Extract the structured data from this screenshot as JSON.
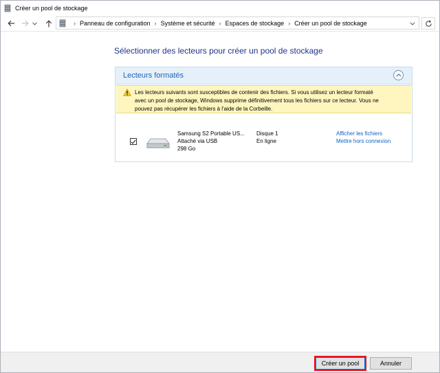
{
  "window": {
    "title": "Créer un pool de stockage"
  },
  "breadcrumb": [
    "Panneau de configuration",
    "Système et sécurité",
    "Espaces de stockage",
    "Créer un pool de stockage"
  ],
  "main": {
    "heading": "Sélectionner des lecteurs pour créer un pool de stockage",
    "panel": {
      "title": "Lecteurs formatés",
      "warning_lines": [
        "Les lecteurs suivants sont susceptibles de contenir des fichiers. Si vous utilisez un lecteur formaté",
        "avec un pool de stockage, Windows supprime définitivement tous les fichiers sur ce lecteur. Vous ne",
        "pouvez pas récupérer les fichiers à l'aide de la Corbeille."
      ],
      "drive": {
        "name": "Samsung S2 Portable US...",
        "connection": "Attaché via USB",
        "size": "298 Go",
        "disk": "Disque 1",
        "status": "En ligne",
        "checked": true,
        "actions": [
          "Afficher les fichiers",
          "Mettre hors connexion"
        ]
      }
    }
  },
  "footer": {
    "create_label": "Créer un pool",
    "cancel_label": "Annuler"
  },
  "colors": {
    "heading": "#1e3287",
    "panel_title": "#1f63b4",
    "link": "#0b62c4",
    "warning_bg": "#fff6bf",
    "highlight": "#e81123"
  },
  "icons": [
    "storage-spaces-icon",
    "back-arrow-icon",
    "forward-arrow-icon",
    "dropdown-arrow-icon",
    "up-arrow-icon",
    "chevron-right-icon",
    "chevron-down-icon",
    "refresh-icon",
    "collapse-icon",
    "warning-icon",
    "checkbox-checked-icon",
    "external-drive-icon"
  ]
}
